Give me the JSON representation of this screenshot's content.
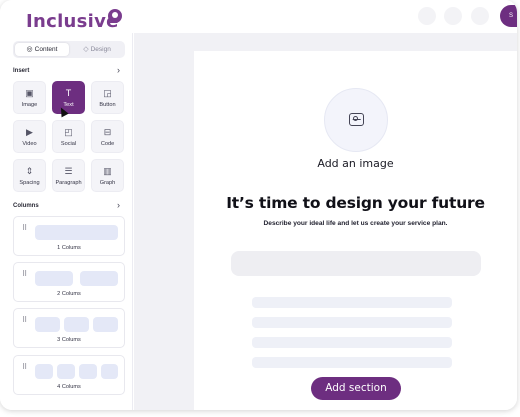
{
  "app": {
    "logo_text": "Inclusive",
    "header_button_label": "S"
  },
  "sidebar": {
    "tabs": [
      {
        "label": "Content",
        "icon": "palette-icon",
        "active": true
      },
      {
        "label": "Design",
        "icon": "droplet-icon",
        "active": false
      }
    ],
    "insert": {
      "title": "Insert",
      "items": [
        {
          "label": "Image",
          "icon": "image-icon"
        },
        {
          "label": "Text",
          "icon": "text-icon",
          "active": true
        },
        {
          "label": "Button",
          "icon": "button-icon"
        },
        {
          "label": "Video",
          "icon": "video-icon"
        },
        {
          "label": "Social",
          "icon": "social-icon"
        },
        {
          "label": "Code",
          "icon": "code-icon"
        },
        {
          "label": "Spacing",
          "icon": "spacing-icon"
        },
        {
          "label": "Paragraph",
          "icon": "paragraph-icon"
        },
        {
          "label": "Graph",
          "icon": "graph-icon"
        }
      ]
    },
    "columns": {
      "title": "Columns",
      "items": [
        {
          "label": "1 Colums",
          "count": 1
        },
        {
          "label": "2 Colums",
          "count": 2
        },
        {
          "label": "3 Colums",
          "count": 3
        },
        {
          "label": "4 Colums",
          "count": 4
        }
      ]
    }
  },
  "page": {
    "add_image_label": "Add an image",
    "headline": "It’s time to design your future",
    "subline": "Describe your ideal life and let us create your service plan.",
    "add_section_label": "Add section"
  },
  "colors": {
    "brand": "#7a3c8e",
    "button": "#6d2e80",
    "canvas_bg": "#f1f1f5",
    "placeholder": "#e4e8f7"
  }
}
